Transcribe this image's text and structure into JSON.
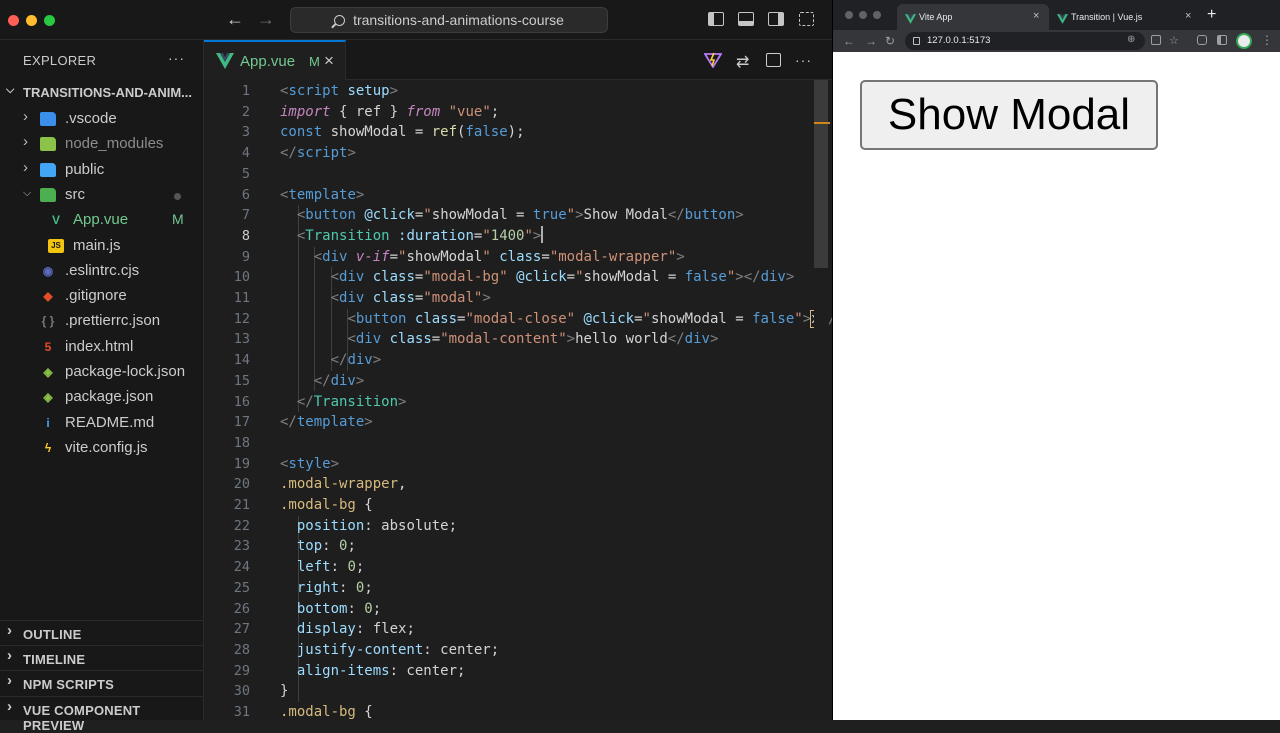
{
  "vscode": {
    "command_center": "transitions-and-animations-course",
    "explorer_title": "EXPLORER",
    "root_folder": "TRANSITIONS-AND-ANIM...",
    "tree": [
      {
        "label": "vscode_label",
        "text": ".vscode",
        "type": "folder",
        "icon_color": "#3b8eea"
      },
      {
        "text": "node_modules",
        "type": "folder",
        "icon_color": "#8bc34a",
        "dimmed": true
      },
      {
        "text": "public",
        "type": "folder",
        "icon_color": "#42a5f5"
      },
      {
        "text": "src",
        "type": "folder-open",
        "icon_color": "#4caf50"
      },
      {
        "text": "App.vue",
        "type": "vue",
        "icon_color": "#41b883",
        "badge": "M"
      },
      {
        "text": "main.js",
        "type": "js",
        "icon_color": "#f1c40f"
      },
      {
        "text": ".eslintrc.cjs",
        "type": "eslint",
        "icon_color": "#5c6bc0"
      },
      {
        "text": ".gitignore",
        "type": "git",
        "icon_color": "#e44d26"
      },
      {
        "text": ".prettierrc.json",
        "type": "json",
        "icon_color": "#777777"
      },
      {
        "text": "index.html",
        "type": "html",
        "icon_color": "#e44d26"
      },
      {
        "text": "package-lock.json",
        "type": "npm",
        "icon_color": "#8bc34a"
      },
      {
        "text": "package.json",
        "type": "npm",
        "icon_color": "#8bc34a"
      },
      {
        "text": "README.md",
        "type": "info",
        "icon_color": "#42a5f5"
      },
      {
        "text": "vite.config.js",
        "type": "vite",
        "icon_color": "#ffca28"
      }
    ],
    "sections": [
      "OUTLINE",
      "TIMELINE",
      "NPM SCRIPTS",
      "VUE COMPONENT PREVIEW"
    ],
    "tab": {
      "name": "App.vue",
      "modified": "M",
      "close": "×"
    },
    "editor": {
      "current_line": 8,
      "lines": [
        {
          "n": "1",
          "html": "<span class='t-br'>&lt;</span><span class='t-tag'>script</span> <span class='t-attr'>setup</span><span class='t-br'>&gt;</span>"
        },
        {
          "n": "2",
          "html": "<span class='t-kw'>import</span> <span class='t-pl'>{ ref } </span><span class='t-kw'>from</span> <span class='t-str'>\"vue\"</span><span class='t-pl'>;</span>"
        },
        {
          "n": "3",
          "html": "<span class='t-bool'>const</span> <span class='t-pl'>showModal = </span><span class='t-fn'>ref</span><span class='t-pl'>(</span><span class='t-bool'>false</span><span class='t-pl'>);</span>"
        },
        {
          "n": "4",
          "html": "<span class='t-br'>&lt;/</span><span class='t-tag'>script</span><span class='t-br'>&gt;</span>"
        },
        {
          "n": "5",
          "html": ""
        },
        {
          "n": "6",
          "html": "<span class='t-br'>&lt;</span><span class='t-tag'>template</span><span class='t-br'>&gt;</span>"
        },
        {
          "n": "7",
          "html": "  <span class='t-br'>&lt;</span><span class='t-tag'>button</span> <span class='t-attr'>@click</span><span class='t-pl'>=</span><span class='t-str'>\"</span><span class='t-pl'>showModal = </span><span class='t-bool'>true</span><span class='t-str'>\"</span><span class='t-br'>&gt;</span><span class='t-pl'>Show Modal</span><span class='t-br'>&lt;/</span><span class='t-tag'>button</span><span class='t-br'>&gt;</span>"
        },
        {
          "n": "8",
          "html": "  <span class='t-br'>&lt;</span><span class='t-comp'>Transition</span> <span class='t-attr'>:duration</span><span class='t-pl'>=</span><span class='t-str'>\"</span><span class='t-num'>1400</span><span class='t-str'>\"</span><span class='t-br'>&gt;</span><span class='cursor'></span>"
        },
        {
          "n": "9",
          "html": "    <span class='t-br'>&lt;</span><span class='t-tag'>div</span> <span class='t-kw'>v-if</span><span class='t-pl'>=</span><span class='t-str'>\"</span><span class='t-pl'>showModal</span><span class='t-str'>\"</span> <span class='t-attr'>class</span><span class='t-pl'>=</span><span class='t-str'>\"modal-wrapper\"</span><span class='t-br'>&gt;</span>"
        },
        {
          "n": "10",
          "html": "      <span class='t-br'>&lt;</span><span class='t-tag'>div</span> <span class='t-attr'>class</span><span class='t-pl'>=</span><span class='t-str'>\"modal-bg\"</span> <span class='t-attr'>@click</span><span class='t-pl'>=</span><span class='t-str'>\"</span><span class='t-pl'>showModal = </span><span class='t-bool'>false</span><span class='t-str'>\"</span><span class='t-br'>&gt;&lt;/</span><span class='t-tag'>div</span><span class='t-br'>&gt;</span>"
        },
        {
          "n": "11",
          "html": "      <span class='t-br'>&lt;</span><span class='t-tag'>div</span> <span class='t-attr'>class</span><span class='t-pl'>=</span><span class='t-str'>\"modal\"</span><span class='t-br'>&gt;</span>"
        },
        {
          "n": "12",
          "html": "        <span class='t-br'>&lt;</span><span class='t-tag'>button</span> <span class='t-attr'>class</span><span class='t-pl'>=</span><span class='t-str'>\"modal-close\"</span> <span class='t-attr'>@click</span><span class='t-pl'>=</span><span class='t-str'>\"</span><span class='t-pl'>showModal = </span><span class='t-bool'>false</span><span class='t-str'>\"</span><span class='t-br'>&gt;</span><span class='t-pl' style='outline:1px solid #d7ba7d'>x</span><span class='t-br'>&lt;/</span>"
        },
        {
          "n": "13",
          "html": "        <span class='t-br'>&lt;</span><span class='t-tag'>div</span> <span class='t-attr'>class</span><span class='t-pl'>=</span><span class='t-str'>\"modal-content\"</span><span class='t-br'>&gt;</span><span class='t-pl'>hello world</span><span class='t-br'>&lt;/</span><span class='t-tag'>div</span><span class='t-br'>&gt;</span>"
        },
        {
          "n": "14",
          "html": "      <span class='t-br'>&lt;/</span><span class='t-tag'>div</span><span class='t-br'>&gt;</span>"
        },
        {
          "n": "15",
          "html": "    <span class='t-br'>&lt;/</span><span class='t-tag'>div</span><span class='t-br'>&gt;</span>"
        },
        {
          "n": "16",
          "html": "  <span class='t-br'>&lt;/</span><span class='t-comp'>Transition</span><span class='t-br'>&gt;</span>"
        },
        {
          "n": "17",
          "html": "<span class='t-br'>&lt;/</span><span class='t-tag'>template</span><span class='t-br'>&gt;</span>"
        },
        {
          "n": "18",
          "html": ""
        },
        {
          "n": "19",
          "html": "<span class='t-br'>&lt;</span><span class='t-tag'>style</span><span class='t-br'>&gt;</span>"
        },
        {
          "n": "20",
          "html": "<span class='t-sel'>.modal-wrapper</span><span class='t-pl'>,</span>"
        },
        {
          "n": "21",
          "html": "<span class='t-sel'>.modal-bg</span> <span class='t-pl'>{</span>"
        },
        {
          "n": "22",
          "html": "  <span class='t-prop'>position</span><span class='t-pl'>: absolute;</span>"
        },
        {
          "n": "23",
          "html": "  <span class='t-prop'>top</span><span class='t-pl'>: </span><span class='t-num'>0</span><span class='t-pl'>;</span>"
        },
        {
          "n": "24",
          "html": "  <span class='t-prop'>left</span><span class='t-pl'>: </span><span class='t-num'>0</span><span class='t-pl'>;</span>"
        },
        {
          "n": "25",
          "html": "  <span class='t-prop'>right</span><span class='t-pl'>: </span><span class='t-num'>0</span><span class='t-pl'>;</span>"
        },
        {
          "n": "26",
          "html": "  <span class='t-prop'>bottom</span><span class='t-pl'>: </span><span class='t-num'>0</span><span class='t-pl'>;</span>"
        },
        {
          "n": "27",
          "html": "  <span class='t-prop'>display</span><span class='t-pl'>: flex;</span>"
        },
        {
          "n": "28",
          "html": "  <span class='t-prop'>justify-content</span><span class='t-pl'>: center;</span>"
        },
        {
          "n": "29",
          "html": "  <span class='t-prop'>align-items</span><span class='t-pl'>: center;</span>"
        },
        {
          "n": "30",
          "html": "<span class='t-pl'>}</span>"
        },
        {
          "n": "31",
          "html": "<span class='t-sel'>.modal-bg</span> <span class='t-pl'>{</span>"
        }
      ]
    }
  },
  "browser": {
    "tabs": [
      {
        "title": "Vite App",
        "active": true,
        "close": "×"
      },
      {
        "title": "Transition | Vue.js",
        "active": false,
        "close": "×"
      }
    ],
    "new_tab": "+",
    "url": "127.0.0.1:5173",
    "page_button": "Show Modal"
  }
}
